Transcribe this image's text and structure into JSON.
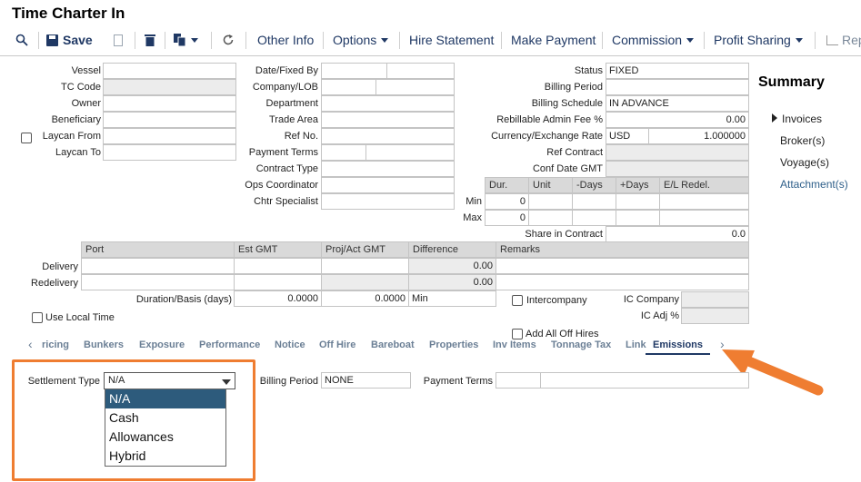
{
  "title": "Time Charter In",
  "toolbar": {
    "save": "Save",
    "other_info": "Other Info",
    "options": "Options",
    "hire_statement": "Hire Statement",
    "make_payment": "Make Payment",
    "commission": "Commission",
    "profit_sharing": "Profit Sharing",
    "rep": "Rep"
  },
  "left": {
    "vessel": "Vessel",
    "tc_code": "TC Code",
    "owner": "Owner",
    "beneficiary": "Beneficiary",
    "laycan_from": "Laycan From",
    "laycan_to": "Laycan To"
  },
  "mid": {
    "date_fixed_by": "Date/Fixed By",
    "company_lob": "Company/LOB",
    "department": "Department",
    "trade_area": "Trade Area",
    "ref_no": "Ref No.",
    "payment_terms": "Payment Terms",
    "contract_type": "Contract Type",
    "ops_coordinator": "Ops Coordinator",
    "chtr_specialist": "Chtr Specialist"
  },
  "right": {
    "status_label": "Status",
    "status_value": "FIXED",
    "billing_period": "Billing Period",
    "billing_schedule_label": "Billing Schedule",
    "billing_schedule_value": "IN ADVANCE",
    "rebillable_label": "Rebillable Admin Fee %",
    "rebillable_value": "0.00",
    "currency_label": "Currency/Exchange Rate",
    "currency_value": "USD",
    "exchange_value": "1.000000",
    "ref_contract": "Ref Contract",
    "conf_date": "Conf Date GMT",
    "share_label": "Share in Contract",
    "share_value": "0.0"
  },
  "dur_table": {
    "headers": [
      "Dur.",
      "Unit",
      "-Days",
      "+Days",
      "E/L Redel."
    ],
    "min_label": "Min",
    "max_label": "Max",
    "min_value": "0",
    "max_value": "0"
  },
  "port_table": {
    "headers": [
      "Port",
      "Est GMT",
      "Proj/Act GMT",
      "Difference",
      "Remarks"
    ],
    "delivery": "Delivery",
    "redelivery": "Redelivery",
    "delivery_diff": "0.00",
    "redelivery_diff": "0.00",
    "duration_label": "Duration/Basis (days)",
    "duration_est": "0.0000",
    "duration_proj": "0.0000",
    "duration_basis": "Min"
  },
  "intercompany": "Intercompany",
  "ic_company": "IC Company",
  "ic_adj": "IC Adj %",
  "use_local_time": "Use Local Time",
  "add_all_off_hires": "Add All Off Hires",
  "summary": {
    "title": "Summary",
    "invoices": "Invoices",
    "brokers": "Broker(s)",
    "voyages": "Voyage(s)",
    "attachments": "Attachment(s)"
  },
  "tabs": [
    "ricing",
    "Bunkers",
    "Exposure",
    "Performance",
    "Notice",
    "Off Hire",
    "Bareboat",
    "Properties",
    "Inv Items",
    "Tonnage Tax",
    "Link",
    "Emissions"
  ],
  "emissions": {
    "settlement_type_label": "Settlement Type",
    "settlement_type_value": "N/A",
    "options": [
      "N/A",
      "Cash",
      "Allowances",
      "Hybrid"
    ],
    "billing_period_label": "Billing Period",
    "billing_period_value": "NONE",
    "payment_terms_label": "Payment Terms"
  },
  "colors": {
    "highlight": "#ef7d31",
    "selected_option": "#2d5b7c",
    "link": "#1f3864"
  }
}
